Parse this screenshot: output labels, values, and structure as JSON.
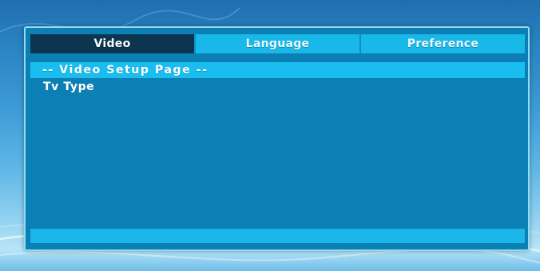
{
  "tabs": [
    {
      "label": "Video",
      "active": true
    },
    {
      "label": "Language",
      "active": false
    },
    {
      "label": "Preference",
      "active": false
    }
  ],
  "page": {
    "header": "-- Video Setup Page --",
    "items": [
      {
        "label": "Tv Type"
      }
    ]
  },
  "colors": {
    "panel": "#0c7fb4",
    "tab_inactive": "#18b8e8",
    "tab_active": "#0d3550",
    "header_bar": "#19bdf0"
  }
}
